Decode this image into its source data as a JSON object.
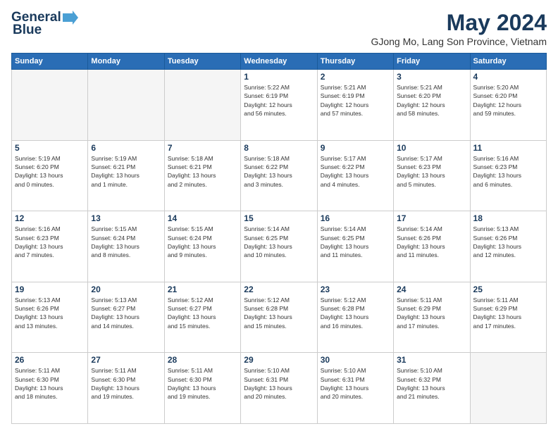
{
  "header": {
    "logo_line1": "General",
    "logo_line2": "Blue",
    "month": "May 2024",
    "location": "GJong Mo, Lang Son Province, Vietnam"
  },
  "weekdays": [
    "Sunday",
    "Monday",
    "Tuesday",
    "Wednesday",
    "Thursday",
    "Friday",
    "Saturday"
  ],
  "weeks": [
    [
      {
        "day": "",
        "info": "",
        "empty": true
      },
      {
        "day": "",
        "info": "",
        "empty": true
      },
      {
        "day": "",
        "info": "",
        "empty": true
      },
      {
        "day": "1",
        "info": "Sunrise: 5:22 AM\nSunset: 6:19 PM\nDaylight: 12 hours\nand 56 minutes."
      },
      {
        "day": "2",
        "info": "Sunrise: 5:21 AM\nSunset: 6:19 PM\nDaylight: 12 hours\nand 57 minutes."
      },
      {
        "day": "3",
        "info": "Sunrise: 5:21 AM\nSunset: 6:20 PM\nDaylight: 12 hours\nand 58 minutes."
      },
      {
        "day": "4",
        "info": "Sunrise: 5:20 AM\nSunset: 6:20 PM\nDaylight: 12 hours\nand 59 minutes."
      }
    ],
    [
      {
        "day": "5",
        "info": "Sunrise: 5:19 AM\nSunset: 6:20 PM\nDaylight: 13 hours\nand 0 minutes."
      },
      {
        "day": "6",
        "info": "Sunrise: 5:19 AM\nSunset: 6:21 PM\nDaylight: 13 hours\nand 1 minute."
      },
      {
        "day": "7",
        "info": "Sunrise: 5:18 AM\nSunset: 6:21 PM\nDaylight: 13 hours\nand 2 minutes."
      },
      {
        "day": "8",
        "info": "Sunrise: 5:18 AM\nSunset: 6:22 PM\nDaylight: 13 hours\nand 3 minutes."
      },
      {
        "day": "9",
        "info": "Sunrise: 5:17 AM\nSunset: 6:22 PM\nDaylight: 13 hours\nand 4 minutes."
      },
      {
        "day": "10",
        "info": "Sunrise: 5:17 AM\nSunset: 6:23 PM\nDaylight: 13 hours\nand 5 minutes."
      },
      {
        "day": "11",
        "info": "Sunrise: 5:16 AM\nSunset: 6:23 PM\nDaylight: 13 hours\nand 6 minutes."
      }
    ],
    [
      {
        "day": "12",
        "info": "Sunrise: 5:16 AM\nSunset: 6:23 PM\nDaylight: 13 hours\nand 7 minutes."
      },
      {
        "day": "13",
        "info": "Sunrise: 5:15 AM\nSunset: 6:24 PM\nDaylight: 13 hours\nand 8 minutes."
      },
      {
        "day": "14",
        "info": "Sunrise: 5:15 AM\nSunset: 6:24 PM\nDaylight: 13 hours\nand 9 minutes."
      },
      {
        "day": "15",
        "info": "Sunrise: 5:14 AM\nSunset: 6:25 PM\nDaylight: 13 hours\nand 10 minutes."
      },
      {
        "day": "16",
        "info": "Sunrise: 5:14 AM\nSunset: 6:25 PM\nDaylight: 13 hours\nand 11 minutes."
      },
      {
        "day": "17",
        "info": "Sunrise: 5:14 AM\nSunset: 6:26 PM\nDaylight: 13 hours\nand 11 minutes."
      },
      {
        "day": "18",
        "info": "Sunrise: 5:13 AM\nSunset: 6:26 PM\nDaylight: 13 hours\nand 12 minutes."
      }
    ],
    [
      {
        "day": "19",
        "info": "Sunrise: 5:13 AM\nSunset: 6:26 PM\nDaylight: 13 hours\nand 13 minutes."
      },
      {
        "day": "20",
        "info": "Sunrise: 5:13 AM\nSunset: 6:27 PM\nDaylight: 13 hours\nand 14 minutes."
      },
      {
        "day": "21",
        "info": "Sunrise: 5:12 AM\nSunset: 6:27 PM\nDaylight: 13 hours\nand 15 minutes."
      },
      {
        "day": "22",
        "info": "Sunrise: 5:12 AM\nSunset: 6:28 PM\nDaylight: 13 hours\nand 15 minutes."
      },
      {
        "day": "23",
        "info": "Sunrise: 5:12 AM\nSunset: 6:28 PM\nDaylight: 13 hours\nand 16 minutes."
      },
      {
        "day": "24",
        "info": "Sunrise: 5:11 AM\nSunset: 6:29 PM\nDaylight: 13 hours\nand 17 minutes."
      },
      {
        "day": "25",
        "info": "Sunrise: 5:11 AM\nSunset: 6:29 PM\nDaylight: 13 hours\nand 17 minutes."
      }
    ],
    [
      {
        "day": "26",
        "info": "Sunrise: 5:11 AM\nSunset: 6:30 PM\nDaylight: 13 hours\nand 18 minutes."
      },
      {
        "day": "27",
        "info": "Sunrise: 5:11 AM\nSunset: 6:30 PM\nDaylight: 13 hours\nand 19 minutes."
      },
      {
        "day": "28",
        "info": "Sunrise: 5:11 AM\nSunset: 6:30 PM\nDaylight: 13 hours\nand 19 minutes."
      },
      {
        "day": "29",
        "info": "Sunrise: 5:10 AM\nSunset: 6:31 PM\nDaylight: 13 hours\nand 20 minutes."
      },
      {
        "day": "30",
        "info": "Sunrise: 5:10 AM\nSunset: 6:31 PM\nDaylight: 13 hours\nand 20 minutes."
      },
      {
        "day": "31",
        "info": "Sunrise: 5:10 AM\nSunset: 6:32 PM\nDaylight: 13 hours\nand 21 minutes."
      },
      {
        "day": "",
        "info": "",
        "empty": true
      }
    ]
  ]
}
